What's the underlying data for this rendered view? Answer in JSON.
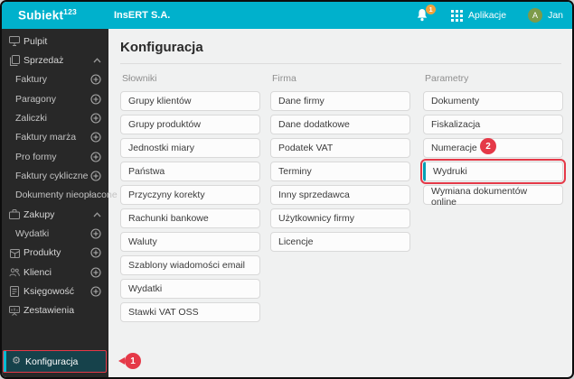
{
  "topbar": {
    "logo_text": "Subiekt",
    "logo_sup": "123",
    "company_name": "InsERT S.A.",
    "notifications_count": "1",
    "apps_label": "Aplikacje",
    "user_initial": "A",
    "user_name": "Jan"
  },
  "sidebar": {
    "items": [
      {
        "label": "Pulpit",
        "icon": "desktop-icon",
        "type": "parent"
      },
      {
        "label": "Sprzedaż",
        "icon": "sales-icon",
        "type": "parent",
        "expanded": true
      },
      {
        "label": "Faktury",
        "type": "sub",
        "has_plus": true
      },
      {
        "label": "Paragony",
        "type": "sub",
        "has_plus": true
      },
      {
        "label": "Zaliczki",
        "type": "sub",
        "has_plus": true
      },
      {
        "label": "Faktury marża",
        "type": "sub",
        "has_plus": true
      },
      {
        "label": "Pro formy",
        "type": "sub",
        "has_plus": true
      },
      {
        "label": "Faktury cykliczne",
        "type": "sub",
        "has_plus": true
      },
      {
        "label": "Dokumenty nieopłacone",
        "type": "sub",
        "has_plus": false
      },
      {
        "label": "Zakupy",
        "icon": "purchases-icon",
        "type": "parent",
        "expanded": true
      },
      {
        "label": "Wydatki",
        "type": "sub",
        "has_plus": true
      },
      {
        "label": "Produkty",
        "icon": "products-icon",
        "type": "parent",
        "has_plus": true
      },
      {
        "label": "Klienci",
        "icon": "clients-icon",
        "type": "parent",
        "has_plus": true
      },
      {
        "label": "Księgowość",
        "icon": "accounting-icon",
        "type": "parent",
        "has_plus": true
      },
      {
        "label": "Zestawienia",
        "icon": "reports-icon",
        "type": "parent"
      }
    ],
    "config_item": {
      "label": "Konfiguracja",
      "icon": "gear-icon",
      "selected": true
    }
  },
  "main": {
    "title": "Konfiguracja",
    "columns": [
      {
        "header": "Słowniki",
        "items": [
          "Grupy klientów",
          "Grupy produktów",
          "Jednostki miary",
          "Państwa",
          "Przyczyny korekty",
          "Rachunki bankowe",
          "Waluty",
          "Szablony wiadomości email",
          "Wydatki",
          "Stawki VAT OSS"
        ]
      },
      {
        "header": "Firma",
        "items": [
          "Dane firmy",
          "Dane dodatkowe",
          "Podatek VAT",
          "Terminy",
          "Inny sprzedawca",
          "Użytkownicy firmy",
          "Licencje"
        ]
      },
      {
        "header": "Parametry",
        "items": [
          "Dokumenty",
          "Fiskalizacja",
          "Numeracje",
          "Wydruki",
          "Wymiana dokumentów online"
        ],
        "highlighted_item": "Wydruki"
      }
    ]
  },
  "callouts": {
    "one": "1",
    "two": "2"
  },
  "colors": {
    "topbar_teal": "#00b1cc",
    "sidebar_dark": "#282828",
    "selected_row_bg": "#16424b",
    "accent_cyan": "#00bcd4",
    "callout_red": "#e53948",
    "badge_orange": "#f2a33c",
    "avatar_green": "#7d9b49",
    "main_bg": "#f0f1f1"
  }
}
